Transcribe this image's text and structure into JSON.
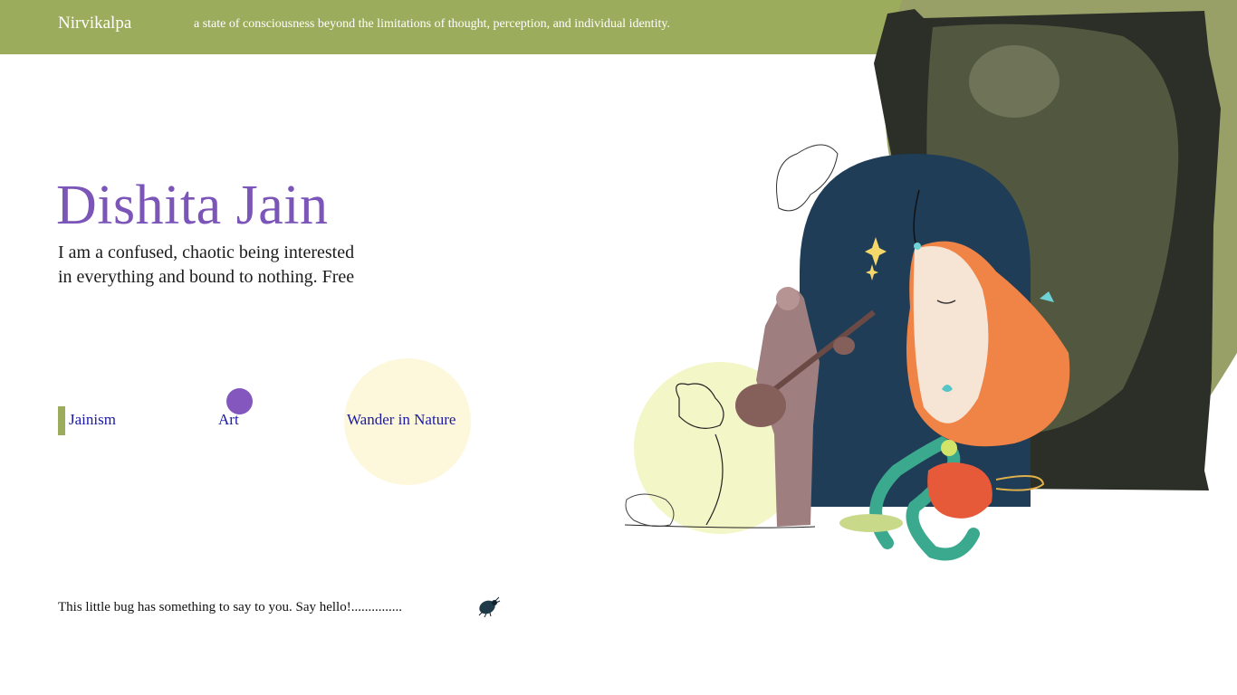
{
  "header": {
    "brand": "Nirvikalpa",
    "tagline": "a state of consciousness beyond the limitations of thought, perception, and individual identity."
  },
  "hero": {
    "name": "Dishita Jain",
    "bio_line1": "I am a confused, chaotic being interested",
    "bio_line2": "in everything and bound to nothing. Free"
  },
  "nav": {
    "items": [
      {
        "label": "Jainism"
      },
      {
        "label": "Art"
      },
      {
        "label": "Wander in Nature"
      }
    ]
  },
  "footer": {
    "note": "This little bug has something to say to you. Say hello!..............."
  },
  "colors": {
    "accent_green": "#9bad5c",
    "name_purple": "#7b55b8",
    "link_blue": "#1a1aa6",
    "dot_purple": "#8357bd"
  }
}
